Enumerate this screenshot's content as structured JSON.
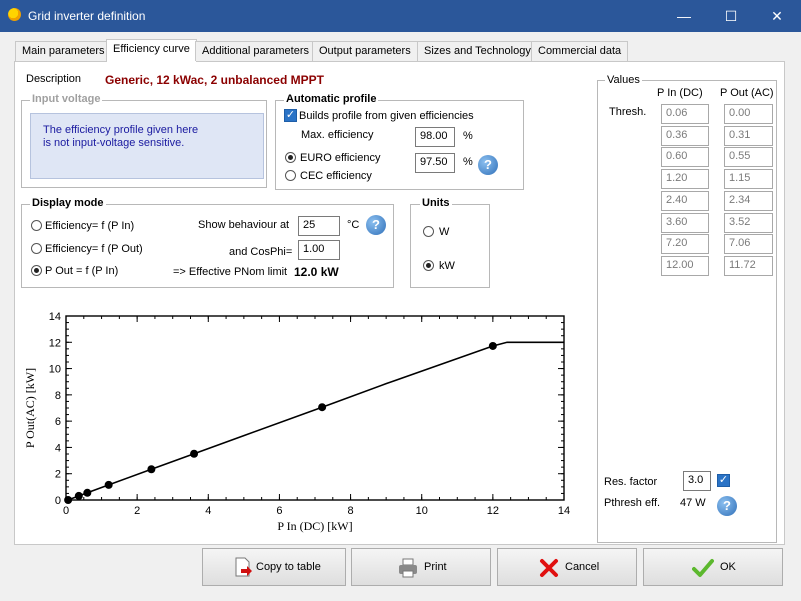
{
  "window": {
    "title": "Grid inverter definition",
    "minimize": "—",
    "maximize": "☐",
    "close": "✕"
  },
  "tabs": [
    {
      "label": "Main parameters"
    },
    {
      "label": "Efficiency curve"
    },
    {
      "label": "Additional parameters"
    },
    {
      "label": "Output parameters"
    },
    {
      "label": "Sizes and Technology"
    },
    {
      "label": "Commercial data"
    }
  ],
  "description": {
    "label": "Description",
    "value": "Generic, 12 kWac, 2 unbalanced MPPT",
    "color": "#8b0000"
  },
  "input_voltage": {
    "title": "Input voltage",
    "message_line1": "The efficiency profile given here",
    "message_line2": "is not input-voltage sensitive."
  },
  "auto_profile": {
    "title": "Automatic profile",
    "builds_label": "Builds profile from given efficiencies",
    "builds_checked": true,
    "max_eff_label": "Max. efficiency",
    "max_eff_value": "98.00",
    "euro_label": "EURO efficiency",
    "euro_selected": true,
    "euro_value": "97.50",
    "cec_label": "CEC efficiency",
    "pct": "%"
  },
  "display_mode": {
    "title": "Display mode",
    "opt1": "Efficiency= f (P In)",
    "opt2": "Efficiency= f (P Out)",
    "opt3": "P Out = f (P In)",
    "selected": "opt3",
    "show_label": "Show behaviour at",
    "temp_value": "25",
    "temp_unit": "°C",
    "cosphi_label": "and CosPhi=",
    "cosphi_value": "1.00",
    "pnom_label": "=> Effective PNom limit",
    "pnom_value": "12.0 kW"
  },
  "units": {
    "title": "Units",
    "w": "W",
    "kw": "kW",
    "selected": "kW"
  },
  "values_panel": {
    "title": "Values",
    "col_in": "P In (DC)",
    "col_out": "P Out (AC)",
    "thresh_label": "Thresh.",
    "rows": [
      {
        "pin": "0.06",
        "pout": "0.00"
      },
      {
        "pin": "0.36",
        "pout": "0.31"
      },
      {
        "pin": "0.60",
        "pout": "0.55"
      },
      {
        "pin": "1.20",
        "pout": "1.15"
      },
      {
        "pin": "2.40",
        "pout": "2.34"
      },
      {
        "pin": "3.60",
        "pout": "3.52"
      },
      {
        "pin": "7.20",
        "pout": "7.06"
      },
      {
        "pin": "12.00",
        "pout": "11.72"
      }
    ],
    "res_factor_label": "Res. factor",
    "res_factor_value": "3.0",
    "res_checked": true,
    "pthresh_label": "Pthresh eff.",
    "pthresh_value": "47 W",
    "label_color": "#8b0000"
  },
  "buttons": {
    "copy": "Copy to table",
    "print": "Print",
    "cancel": "Cancel",
    "ok": "OK"
  },
  "chart_data": {
    "type": "line",
    "xlabel": "P In (DC) [kW]",
    "ylabel": "P Out(AC) [kW]",
    "xlim": [
      0,
      14
    ],
    "ylim": [
      0,
      14
    ],
    "xticks": [
      0,
      2,
      4,
      6,
      8,
      10,
      12,
      14
    ],
    "yticks": [
      0,
      2,
      4,
      6,
      8,
      10,
      12,
      14
    ],
    "curve": [
      [
        0.06,
        0.0
      ],
      [
        0.36,
        0.31
      ],
      [
        0.6,
        0.55
      ],
      [
        1.2,
        1.15
      ],
      [
        2.4,
        2.34
      ],
      [
        3.6,
        3.52
      ],
      [
        5.0,
        4.9
      ],
      [
        7.2,
        7.06
      ],
      [
        9.0,
        8.85
      ],
      [
        12.0,
        11.72
      ],
      [
        12.4,
        12.0
      ],
      [
        14.0,
        12.0
      ]
    ],
    "points": [
      [
        0.06,
        0.0
      ],
      [
        0.36,
        0.31
      ],
      [
        0.6,
        0.55
      ],
      [
        1.2,
        1.15
      ],
      [
        2.4,
        2.34
      ],
      [
        3.6,
        3.52
      ],
      [
        7.2,
        7.06
      ],
      [
        12.0,
        11.72
      ]
    ],
    "grid": false
  }
}
